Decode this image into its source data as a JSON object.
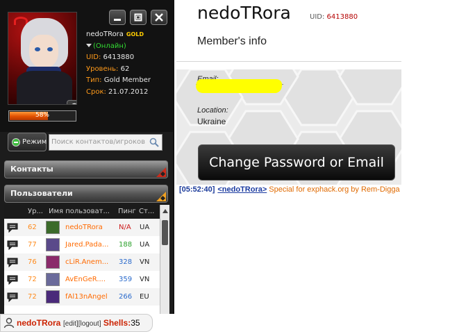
{
  "client": {
    "window_buttons": [
      "minimize",
      "restore",
      "close"
    ],
    "profile": {
      "name": "nedoTRora",
      "badge": "GOLD",
      "status": "(Онлайн)",
      "uid_label": "UID:",
      "uid": "6413880",
      "level_label": "Уровень:",
      "level": "62",
      "type_label": "Тип:",
      "type": "Gold Member",
      "term_label": "Срок:",
      "term": "21.07.2012",
      "xp_text": "58%",
      "xp_percent": 58
    },
    "mode_button": "Режим",
    "search_placeholder": "Поиск контактов/игроков",
    "contacts_label": "Контакты",
    "users_label": "Пользователи",
    "table": {
      "headers": [
        "Ур...",
        "Имя пользоват...",
        "Пинг",
        "Ст..."
      ],
      "rows": [
        {
          "level": "62",
          "name": "nedoTRora",
          "ping": "N/A",
          "ping_color": "#cc1a1a",
          "country": "UA",
          "avatar_color": "#3b6a2a"
        },
        {
          "level": "77",
          "name": "Jared.Pada...",
          "ping": "188",
          "ping_color": "#2aa02a",
          "country": "UA",
          "avatar_color": "#5a4a8a"
        },
        {
          "level": "76",
          "name": "cLiR.Anem...",
          "ping": "328",
          "ping_color": "#2a6acc",
          "country": "VN",
          "avatar_color": "#8a2a6a"
        },
        {
          "level": "72",
          "name": "AvEnGeR....",
          "ping": "359",
          "ping_color": "#2a6acc",
          "country": "VN",
          "avatar_color": "#6a6a9a"
        },
        {
          "level": "72",
          "name": "fAl13nAngel",
          "ping": "266",
          "ping_color": "#2a6acc",
          "country": "EU",
          "avatar_color": "#4a2a7a"
        }
      ]
    }
  },
  "member": {
    "username": "nedoTRora",
    "uid_label": "UID:",
    "uid": "6413880",
    "subtitle": "Member's info",
    "email_label": "Email:",
    "location_label": "Location:",
    "location": "Ukraine",
    "change_button": "Change Password or Email"
  },
  "chat": {
    "time": "[05:52:40]",
    "sender": "<nedoTRora>",
    "message": "Special for exphack.org by Rem-Digga"
  },
  "footer": {
    "name": "nedoTRora",
    "edit": "[edit]",
    "logout": "[logout]",
    "shells_label": "Shells:",
    "shells": "35"
  }
}
